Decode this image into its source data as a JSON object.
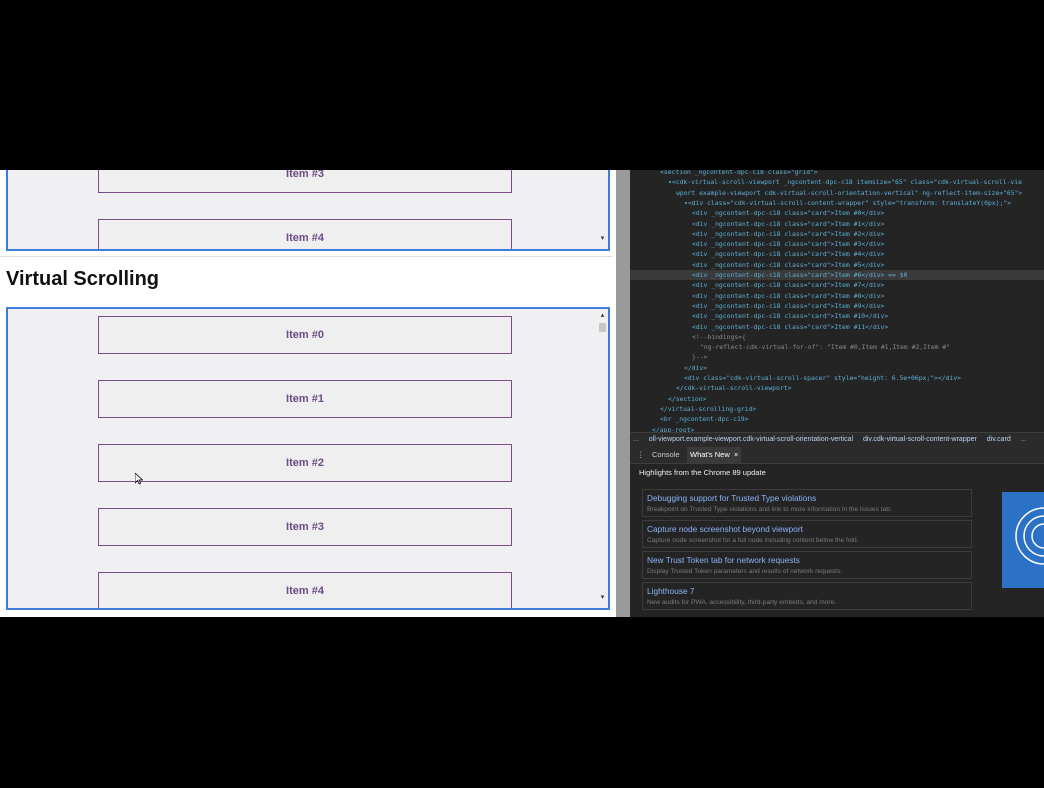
{
  "page": {
    "heading": "Virtual Scrolling",
    "top_viewport_items": [
      "Item #3",
      "Item #4"
    ],
    "main_viewport_items": [
      "Item #0",
      "Item #1",
      "Item #2",
      "Item #3",
      "Item #4"
    ]
  },
  "devtools": {
    "element_lines": [
      {
        "text": "<section _ngcontent-dpc-c18 class=\"grid\">",
        "indent": 0
      },
      {
        "text": "▾<cdk-virtual-scroll-viewport _ngcontent-dpc-c18 itemsize=\"65\" class=\"cdk-virtual-scroll-vie",
        "indent": 1
      },
      {
        "text": "wport example-viewport cdk-virtual-scroll-orientation-vertical\" ng-reflect-item-size=\"65\">",
        "indent": 2
      },
      {
        "text": "▾<div class=\"cdk-virtual-scroll-content-wrapper\" style=\"transform: translateY(0px);\">",
        "indent": 3
      },
      {
        "text": "<div _ngcontent-dpc-c18 class=\"card\">Item #0</div>",
        "indent": 4
      },
      {
        "text": "<div _ngcontent-dpc-c18 class=\"card\">Item #1</div>",
        "indent": 4
      },
      {
        "text": "<div _ngcontent-dpc-c18 class=\"card\">Item #2</div>",
        "indent": 4
      },
      {
        "text": "<div _ngcontent-dpc-c18 class=\"card\">Item #3</div>",
        "indent": 4
      },
      {
        "text": "<div _ngcontent-dpc-c18 class=\"card\">Item #4</div>",
        "indent": 4
      },
      {
        "text": "<div _ngcontent-dpc-c18 class=\"card\">Item #5</div>",
        "indent": 4
      },
      {
        "text": "<div _ngcontent-dpc-c18 class=\"card\">Item #6</div> == $0",
        "indent": 4,
        "selected": true
      },
      {
        "text": "<div _ngcontent-dpc-c18 class=\"card\">Item #7</div>",
        "indent": 4
      },
      {
        "text": "<div _ngcontent-dpc-c18 class=\"card\">Item #8</div>",
        "indent": 4
      },
      {
        "text": "<div _ngcontent-dpc-c18 class=\"card\">Item #9</div>",
        "indent": 4
      },
      {
        "text": "<div _ngcontent-dpc-c18 class=\"card\">Item #10</div>",
        "indent": 4
      },
      {
        "text": "<div _ngcontent-dpc-c18 class=\"card\">Item #11</div>",
        "indent": 4
      },
      {
        "text": "<!--bindings={",
        "indent": 4,
        "comment": true
      },
      {
        "text": "\"ng-reflect-cdk-virtual-for-of\": \"Item #0,Item #1,Item #2,Item #\"",
        "indent": 5,
        "comment": true
      },
      {
        "text": "}-->",
        "indent": 4,
        "comment": true
      },
      {
        "text": "</div>",
        "indent": 3
      },
      {
        "text": "<div class=\"cdk-virtual-scroll-spacer\" style=\"height: 6.5e+06px;\"></div>",
        "indent": 3
      },
      {
        "text": "</cdk-virtual-scroll-viewport>",
        "indent": 2
      },
      {
        "text": "</section>",
        "indent": 1
      },
      {
        "text": "</virtual-scrolling-grid>",
        "indent": 0
      },
      {
        "text": "<br _ngcontent-dpc-c19>",
        "indent": 0
      },
      {
        "text": "</app-root>",
        "indent": -1
      }
    ],
    "breadcrumbs": [
      "...",
      "oll-viewport.example-viewport.cdk-virtual-scroll-orientation-vertical",
      "div.cdk-virtual-scroll-content-wrapper",
      "div.card",
      "..."
    ],
    "drawer_tabs": {
      "menu": "⋮",
      "console": "Console",
      "whats_new": "What's New",
      "close": "×"
    },
    "whats_new_title": "Highlights from the Chrome 89 update",
    "features": [
      {
        "title": "Debugging support for Trusted Type violations",
        "desc": "Breakpoint on Trusted Type violations and link to more information in the Issues tab."
      },
      {
        "title": "Capture node screenshot beyond viewport",
        "desc": "Capture node screenshot for a full node including content below the fold."
      },
      {
        "title": "New Trust Token tab for network requests",
        "desc": "Display Trusted Token parameters and results of network requests."
      },
      {
        "title": "Lighthouse 7",
        "desc": "New audits for PWA, accessibility, third-party embeds, and more."
      }
    ]
  }
}
